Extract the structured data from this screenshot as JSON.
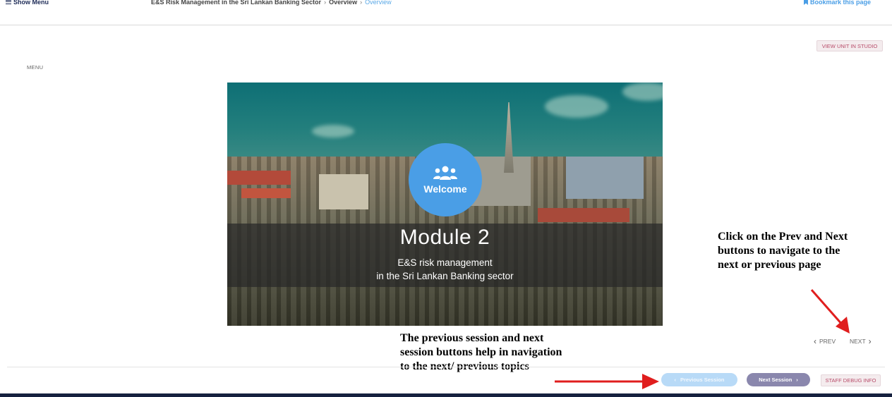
{
  "header": {
    "show_menu_label": "Show Menu",
    "breadcrumb": [
      "E&S Risk Management in the Sri Lankan Banking Sector",
      "Overview",
      "Overview"
    ],
    "bookmark_label": "Bookmark this page"
  },
  "studio": {
    "view_unit_label": "VIEW UNIT IN STUDIO"
  },
  "sidebar": {
    "menu_label": "MENU"
  },
  "hero": {
    "badge_label": "Welcome",
    "badge_icon": "users-icon",
    "title": "Module 2",
    "subtitle_line1": "E&S risk management",
    "subtitle_line2": "in the Sri Lankan Banking sector"
  },
  "annotations": {
    "right_note": "Click on the Prev and Next buttons to navigate to the next or previous page",
    "bottom_note": "The previous session and next session buttons help in navigation to the next/ previous topics"
  },
  "navigation": {
    "prev_label": "PREV",
    "next_label": "NEXT"
  },
  "session_nav": {
    "previous_session_label": "Previous Session",
    "next_session_label": "Next Session",
    "staff_debug_label": "STAFF DEBUG INFO"
  },
  "colors": {
    "accent": "#4a9ee6",
    "brand_dark": "#16213f",
    "next_session_bg": "#8a87ad",
    "prev_session_bg": "#b8daf7",
    "staff_button_text": "#b74a68",
    "arrow": "#e01e1e"
  }
}
